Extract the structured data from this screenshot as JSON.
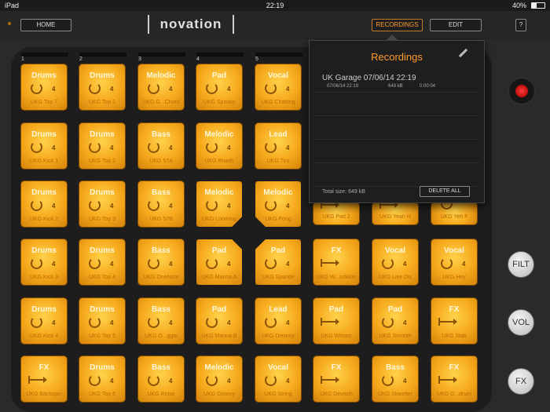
{
  "status": {
    "device": "iPad",
    "time": "22:19",
    "battery": "40%"
  },
  "header": {
    "home_label": "HOME",
    "logo": "novation",
    "recordings_label": "RECORDINGS",
    "edit_label": "EDIT",
    "help_label": "?"
  },
  "columns": [
    "1",
    "2",
    "3",
    "4",
    "5"
  ],
  "pads": [
    [
      {
        "type": "Drums",
        "num": "4",
        "name": "UKG Top 7",
        "mode": "loop"
      },
      {
        "type": "Drums",
        "num": "4",
        "name": "UKG Top 1",
        "mode": "loop"
      },
      {
        "type": "Melodic",
        "num": "4",
        "name": "UKG G...Chord",
        "mode": "loop"
      },
      {
        "type": "Pad",
        "num": "4",
        "name": "UKG Spooky",
        "mode": "loop"
      },
      {
        "type": "Vocal",
        "num": "4",
        "name": "UKG Chatting",
        "mode": "loop"
      }
    ],
    [
      {
        "type": "Drums",
        "num": "4",
        "name": "UKG Kick 1",
        "mode": "loop"
      },
      {
        "type": "Drums",
        "num": "4",
        "name": "UKG Top 2",
        "mode": "loop"
      },
      {
        "type": "Bass",
        "num": "4",
        "name": "UKG 57A",
        "mode": "loop"
      },
      {
        "type": "Melodic",
        "num": "4",
        "name": "UKG Roads",
        "mode": "loop"
      },
      {
        "type": "Lead",
        "num": "4",
        "name": "UKG Tiro",
        "mode": "loop"
      }
    ],
    [
      {
        "type": "Drums",
        "num": "4",
        "name": "UKG Kick 2",
        "mode": "loop"
      },
      {
        "type": "Drums",
        "num": "4",
        "name": "UKG Top 3",
        "mode": "loop"
      },
      {
        "type": "Bass",
        "num": "4",
        "name": "UKG 57B",
        "mode": "loop"
      },
      {
        "type": "Melodic",
        "num": "4",
        "name": "UKG Looming",
        "mode": "loop"
      },
      {
        "type": "Melodic",
        "num": "4",
        "name": "UKG Pong",
        "mode": "loop"
      },
      {
        "type": "",
        "num": "",
        "name": "UKG Pad 2",
        "mode": "oneshot"
      },
      {
        "type": "",
        "num": "",
        "name": "UKG Yeah H",
        "mode": "oneshot"
      },
      {
        "type": "",
        "num": "",
        "name": "UKG Yeh F",
        "mode": "loop"
      }
    ],
    [
      {
        "type": "Drums",
        "num": "4",
        "name": "UKG Kick 3",
        "mode": "loop"
      },
      {
        "type": "Drums",
        "num": "4",
        "name": "UKG Top 4",
        "mode": "loop"
      },
      {
        "type": "Bass",
        "num": "4",
        "name": "UKG OneNote",
        "mode": "loop"
      },
      {
        "type": "Pad",
        "num": "4",
        "name": "UKG Marina A",
        "mode": "loop"
      },
      {
        "type": "Pad",
        "num": "4",
        "name": "UKG Sparkle",
        "mode": "loop"
      },
      {
        "type": "FX",
        "num": "",
        "name": "UKG W...ssWoo",
        "mode": "oneshot"
      },
      {
        "type": "Vocal",
        "num": "4",
        "name": "UKG Like Dis",
        "mode": "loop"
      },
      {
        "type": "Vocal",
        "num": "4",
        "name": "UKG Hey",
        "mode": "loop"
      }
    ],
    [
      {
        "type": "Drums",
        "num": "4",
        "name": "UKG Kick 4",
        "mode": "loop"
      },
      {
        "type": "Drums",
        "num": "4",
        "name": "UKG Top 5",
        "mode": "loop"
      },
      {
        "type": "Bass",
        "num": "4",
        "name": "UKG O...ggio",
        "mode": "loop"
      },
      {
        "type": "Pad",
        "num": "4",
        "name": "UKG Marina B",
        "mode": "loop"
      },
      {
        "type": "Lead",
        "num": "4",
        "name": "UKG Dreamy",
        "mode": "loop"
      },
      {
        "type": "Pad",
        "num": "",
        "name": "UKG Whoirs",
        "mode": "oneshot"
      },
      {
        "type": "Pad",
        "num": "4",
        "name": "UKG Smooth",
        "mode": "loop"
      },
      {
        "type": "FX",
        "num": "",
        "name": "UKG Stab",
        "mode": "oneshot"
      }
    ],
    [
      {
        "type": "FX",
        "num": "",
        "name": "UKG Backspin",
        "mode": "oneshot"
      },
      {
        "type": "Drums",
        "num": "4",
        "name": "UKG Top 6",
        "mode": "loop"
      },
      {
        "type": "Bass",
        "num": "4",
        "name": "UKG Rinse",
        "mode": "loop"
      },
      {
        "type": "Melodic",
        "num": "4",
        "name": "UKG Groovy",
        "mode": "loop"
      },
      {
        "type": "Vocal",
        "num": "4",
        "name": "UKG String",
        "mode": "loop"
      },
      {
        "type": "FX",
        "num": "",
        "name": "UKG Devilish",
        "mode": "oneshot"
      },
      {
        "type": "Bass",
        "num": "4",
        "name": "UKG Skwelter",
        "mode": "loop"
      },
      {
        "type": "FX",
        "num": "",
        "name": "UKG D...drum",
        "mode": "oneshot"
      }
    ]
  ],
  "side": {
    "filt": "FILT",
    "vol": "VOL",
    "fx": "FX"
  },
  "recordings": {
    "title": "Recordings",
    "items": [
      {
        "title": "UK Garage 07/06/14 22:19",
        "date": "07/06/14 22:19",
        "size": "649 kB",
        "duration": "0:00:04"
      }
    ],
    "total": "Total size: 649 kB",
    "delete_label": "DELETE ALL"
  },
  "colors": {
    "pad": "#f6a81c",
    "accent": "#ff9b2e",
    "record": "#e01010"
  }
}
